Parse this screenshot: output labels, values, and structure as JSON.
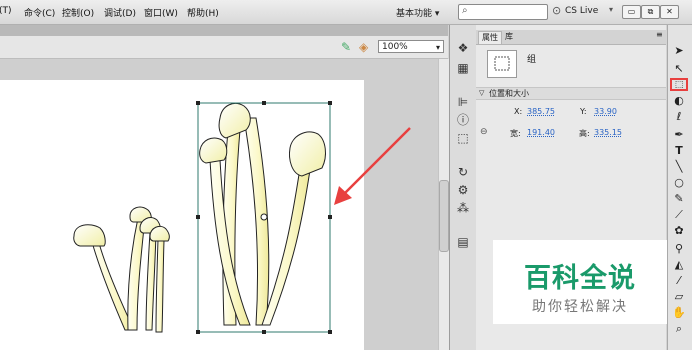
{
  "menu": {
    "items": [
      "(T)",
      "命令(C)",
      "控制(O)",
      "调试(D)",
      "窗口(W)",
      "帮助(H)"
    ],
    "workspace_label": "基本功能 ▾",
    "search_placeholder": "",
    "cs_live_label": "CS Live"
  },
  "editbar": {
    "zoom_value": "100%"
  },
  "properties": {
    "tabs": [
      "属性",
      "库"
    ],
    "instance_type": "组",
    "section_title": "位置和大小",
    "x_label": "X:",
    "x_value": "385.75",
    "y_label": "Y:",
    "y_value": "33.90",
    "width_label": "宽:",
    "width_value": "191.40",
    "height_label": "高:",
    "height_value": "335.15"
  },
  "watermark": {
    "title": "百科全说",
    "subtitle": "助你轻松解决"
  },
  "colors": {
    "annotation_red": "#e8403f",
    "mushroom_fill_light": "#fffff0",
    "mushroom_fill_yellow": "#f3f1a8",
    "watermark_green": "#1a9a6a",
    "link_blue": "#2a64c5"
  }
}
